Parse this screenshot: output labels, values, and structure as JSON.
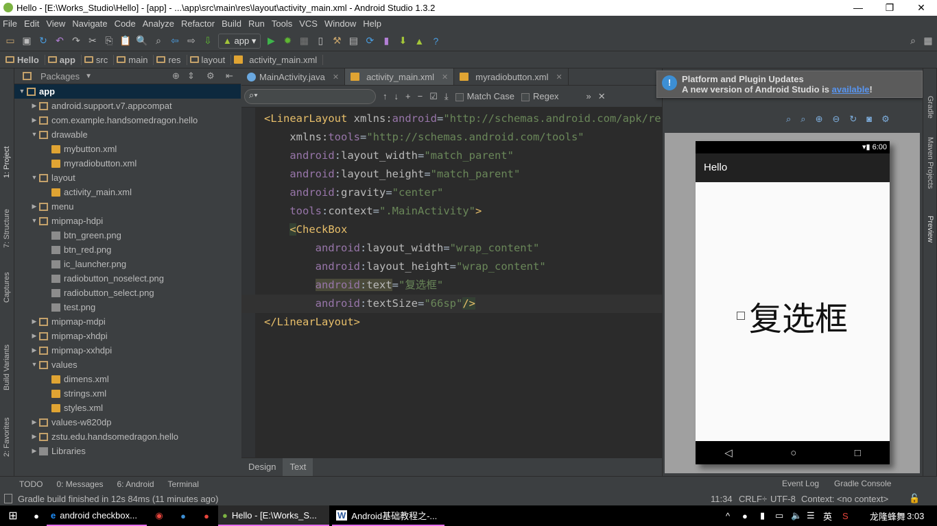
{
  "window": {
    "title": "Hello - [E:\\Works_Studio\\Hello] - [app] - ...\\app\\src\\main\\res\\layout\\activity_main.xml - Android Studio 1.3.2",
    "minimize": "—",
    "maximize": "❐",
    "close": "✕"
  },
  "menu": [
    "File",
    "Edit",
    "View",
    "Navigate",
    "Code",
    "Analyze",
    "Refactor",
    "Build",
    "Run",
    "Tools",
    "VCS",
    "Window",
    "Help"
  ],
  "toolbar": {
    "run_config": "app"
  },
  "breadcrumb": [
    "Hello",
    "app",
    "src",
    "main",
    "res",
    "layout",
    "activity_main.xml"
  ],
  "left_strip": [
    "1: Project",
    "7: Structure",
    "Captures",
    "Build Variants",
    "2: Favorites"
  ],
  "project": {
    "view": "Packages",
    "tree": [
      {
        "label": "app",
        "level": 0,
        "type": "module",
        "open": true
      },
      {
        "label": "android.support.v7.appcompat",
        "level": 1,
        "type": "folder",
        "open": false
      },
      {
        "label": "com.example.handsomedragon.hello",
        "level": 1,
        "type": "folder",
        "open": false
      },
      {
        "label": "drawable",
        "level": 1,
        "type": "folder",
        "open": true
      },
      {
        "label": "mybutton.xml",
        "level": 2,
        "type": "file"
      },
      {
        "label": "myradiobutton.xml",
        "level": 2,
        "type": "file"
      },
      {
        "label": "layout",
        "level": 1,
        "type": "folder",
        "open": true
      },
      {
        "label": "activity_main.xml",
        "level": 2,
        "type": "file"
      },
      {
        "label": "menu",
        "level": 1,
        "type": "folder",
        "open": false
      },
      {
        "label": "mipmap-hdpi",
        "level": 1,
        "type": "folder",
        "open": true
      },
      {
        "label": "btn_green.png",
        "level": 2,
        "type": "img"
      },
      {
        "label": "btn_red.png",
        "level": 2,
        "type": "img"
      },
      {
        "label": "ic_launcher.png",
        "level": 2,
        "type": "img"
      },
      {
        "label": "radiobutton_noselect.png",
        "level": 2,
        "type": "img"
      },
      {
        "label": "radiobutton_select.png",
        "level": 2,
        "type": "img"
      },
      {
        "label": "test.png",
        "level": 2,
        "type": "img"
      },
      {
        "label": "mipmap-mdpi",
        "level": 1,
        "type": "folder",
        "open": false
      },
      {
        "label": "mipmap-xhdpi",
        "level": 1,
        "type": "folder",
        "open": false
      },
      {
        "label": "mipmap-xxhdpi",
        "level": 1,
        "type": "folder",
        "open": false
      },
      {
        "label": "values",
        "level": 1,
        "type": "folder",
        "open": true
      },
      {
        "label": "dimens.xml",
        "level": 2,
        "type": "file"
      },
      {
        "label": "strings.xml",
        "level": 2,
        "type": "file"
      },
      {
        "label": "styles.xml",
        "level": 2,
        "type": "file"
      },
      {
        "label": "values-w820dp",
        "level": 1,
        "type": "folder",
        "open": false
      },
      {
        "label": "zstu.edu.handsomedragon.hello",
        "level": 1,
        "type": "folder",
        "open": false
      },
      {
        "label": "Libraries",
        "level": 1,
        "type": "lib",
        "open": false
      }
    ]
  },
  "editor": {
    "tabs": [
      {
        "label": "MainActivity.java",
        "active": false
      },
      {
        "label": "activity_main.xml",
        "active": true
      },
      {
        "label": "myradiobutton.xml",
        "active": false
      }
    ],
    "search": {
      "value": "",
      "match_case": "Match Case",
      "regex": "Regex"
    },
    "bottom_tabs": [
      "Design",
      "Text"
    ],
    "active_bottom_tab": "Text"
  },
  "notification": {
    "title": "Platform and Plugin Updates",
    "text": "A new version of Android Studio is ",
    "link": "available",
    "suffix": "!"
  },
  "preview": {
    "status_time": "6:00",
    "app_title": "Hello",
    "checkbox_text": "复选框",
    "checked": false
  },
  "right_strip": [
    "Gradle",
    "Maven Projects",
    "Preview"
  ],
  "bottom_tools": [
    "TODO",
    "0: Messages",
    "6: Android",
    "Terminal"
  ],
  "bottom_tools_right": [
    "Event Log",
    "Gradle Console"
  ],
  "status": {
    "message": "Gradle build finished in 12s 84ms (11 minutes ago)",
    "position": "11:34",
    "line_sep": "CRLF÷",
    "encoding": "UTF-8",
    "context": "Context: <no context>"
  },
  "taskbar": {
    "items": [
      "android checkbox...",
      "Hello - [E:\\Works_S...",
      "Android基础教程之-..."
    ],
    "ime": "英",
    "user": "龙隆蜂舞",
    "time": "3:03"
  },
  "colors": {
    "tag": "#e8bf6a",
    "namespace": "#9876aa",
    "value": "#6a8759",
    "editor_bg": "#2b2b2b",
    "panel_bg": "#3c3f41",
    "selection": "#0d293e"
  }
}
